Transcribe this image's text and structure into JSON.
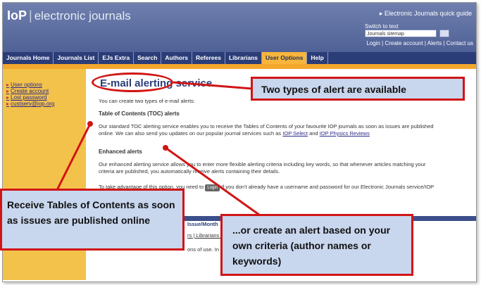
{
  "header": {
    "logo_mark": "IoP",
    "logo_text": "electronic journals",
    "quick_guide": "▸ Electronic Journals quick guide",
    "switch_label": "Switch to text",
    "switch_select_value": "Journals sitemap",
    "account_links": "Login | Create account | Alerts | Contact us"
  },
  "nav": {
    "items": [
      "Journals Home",
      "Journals List",
      "EJs Extra",
      "Search",
      "Authors",
      "Referees",
      "Librarians",
      "User Options",
      "Help"
    ],
    "active": "User Options"
  },
  "sidebar": {
    "links": [
      "User options",
      "Create account",
      "Lost password",
      "custserv@iop.org"
    ]
  },
  "content": {
    "title": "E-mail alerting service",
    "intro": "You can create two types of e-mail alerts:",
    "toc_heading": "Table of Contents (TOC) alerts",
    "toc_text_1": "Our standard TOC alerting service enables you to receive the Tables of Contents of your favourite IOP journals as soon as issues are published",
    "toc_text_2": "online. We can also send you updates on our popular journal services such as",
    "toc_link_1": "IOP Select",
    "toc_and": "and",
    "toc_link_2": "IOP Physics Reviews",
    "enhanced_heading": "Enhanced alerts",
    "enhanced_text_1": "Our enhanced alerting service allows you to enter more flexible alerting criteria including key words, so that whenever articles matching your",
    "enhanced_text_2": "criteria are published, you automatically receive alerts containing their details.",
    "advantage_text_1": "To take advantage of this option, you need to",
    "login_button": "Login",
    "advantage_text_2": "If you don't already have a username and password for our Electronic Journals service/IOP",
    "footer_month": "Issue/Month",
    "footer_links": "rs | Librarians |",
    "footer_terms": "ons of use. In p"
  },
  "callouts": {
    "types": "Two types of alert are available",
    "toc": "Receive Tables of Contents as soon as issues are published online",
    "criteria": "...or create an alert based on your own criteria (author names or keywords)"
  },
  "colors": {
    "accent_red": "#d11515",
    "nav_blue": "#2b3d78",
    "sidebar_gold": "#f3c24b",
    "callout_fill": "#c8d6ee"
  }
}
